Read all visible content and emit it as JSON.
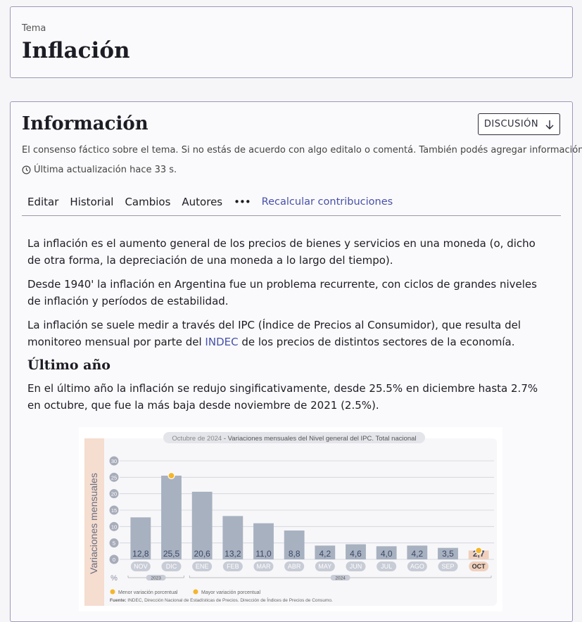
{
  "topic": {
    "label": "Tema",
    "title": "Inflación"
  },
  "info": {
    "title": "Información",
    "discuss_label": "DISCUSIÓN",
    "subtitle": "El consenso fáctico sobre el tema. Si no estás de acuerdo con algo editalo o comentá. También podés agregar información.",
    "updated": "Última actualización hace 33 s."
  },
  "menu": {
    "edit": "Editar",
    "history": "Historial",
    "changes": "Cambios",
    "authors": "Autores",
    "more": "•••",
    "recalc": "Recalcular contribuciones"
  },
  "article": {
    "p1": "La inflación es el aumento general de los precios de bienes y servicios en una moneda (o, dicho de otra forma, la depreciación de una moneda a lo largo del tiempo).",
    "p2": "Desde 1940' la inflación en Argentina fue un problema recurrente, con ciclos de grandes niveles de inflación y períodos de estabilidad.",
    "p3_before": "La inflación se suele medir a través del IPC (Índice de Precios al Consumidor), que resulta del monitoreo mensual por parte del ",
    "p3_link": "INDEC",
    "p3_after": " de los precios de distintos sectores de la economía.",
    "h2": "Último año",
    "p4": "En el último año la inflación se redujo singificativamente, desde 25.5% en diciembre hasta 2.7% en octubre, que fue la más baja desde noviembre de 2021 (2.5%)."
  },
  "chart_data": {
    "type": "bar",
    "title_prefix": "Octubre de 2024",
    "title": "Variaciones mensuales del Nivel general del IPC. Total nacional",
    "ylabel": "Variaciones mensuales",
    "yunit": "%",
    "ylim": [
      0,
      30
    ],
    "yticks": [
      0,
      5,
      10,
      15,
      20,
      25,
      30
    ],
    "categories": [
      "NOV",
      "DIC",
      "ENE",
      "FEB",
      "MAR",
      "ABR",
      "MAY",
      "JUN",
      "JUL",
      "AGO",
      "SEP",
      "OCT"
    ],
    "values": [
      12.8,
      25.5,
      20.6,
      13.2,
      11.0,
      8.8,
      4.2,
      4.6,
      4.0,
      4.2,
      3.5,
      2.7
    ],
    "value_labels": [
      "12,8",
      "25,5",
      "20,6",
      "13,2",
      "11,0",
      "8,8",
      "4,2",
      "4,6",
      "4,0",
      "4,2",
      "3,5",
      "2,7"
    ],
    "year_groups": [
      {
        "label": "2023",
        "from": 0,
        "to": 1
      },
      {
        "label": "2024",
        "from": 2,
        "to": 11
      }
    ],
    "min_marker_index": 11,
    "max_marker_index": 1,
    "legend_min": "Menor variación porcentual",
    "legend_max": "Mayor variación porcentual",
    "source_label": "Fuente:",
    "source_text": "INDEC, Dirección Nacional de Estadísticas de Precios. Dirección de Índices de Precios de Consumo.",
    "colors": {
      "bar": "#a8b1c0",
      "highlight": "#f0d0bc",
      "marker": "#f4b62c",
      "axis_band": "#f5ddd0",
      "pill": "#c8ccd6",
      "grid": "#cfd2da"
    }
  }
}
